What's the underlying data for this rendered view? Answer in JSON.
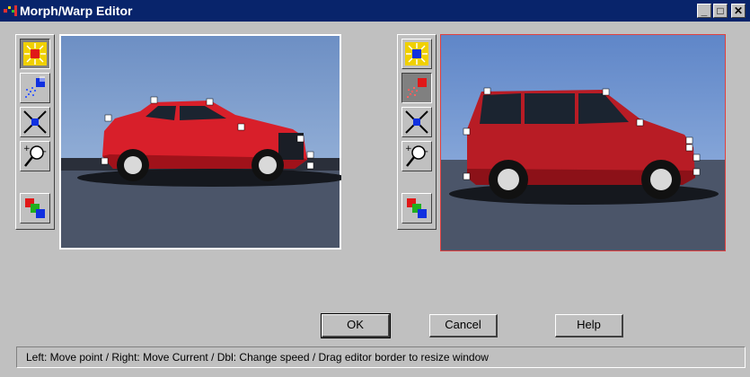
{
  "window": {
    "title": "Morph/Warp Editor",
    "controls": {
      "minimize": "_",
      "maximize": "□",
      "close": "✕"
    }
  },
  "left_toolbox": {
    "tools": [
      {
        "name": "move-point-icon",
        "pressed": true
      },
      {
        "name": "spread-points-icon",
        "pressed": false
      },
      {
        "name": "delete-point-icon",
        "pressed": false
      },
      {
        "name": "zoom-icon",
        "pressed": false
      },
      {
        "name": "color-squares-icon",
        "pressed": false
      }
    ]
  },
  "right_toolbox": {
    "tools": [
      {
        "name": "move-point-icon",
        "pressed": false
      },
      {
        "name": "spread-points-icon",
        "pressed": true
      },
      {
        "name": "delete-point-icon",
        "pressed": false
      },
      {
        "name": "zoom-icon",
        "pressed": false
      },
      {
        "name": "color-squares-icon",
        "pressed": false
      }
    ]
  },
  "source_image": {
    "subject": "red hatchback car side view",
    "frame_color": "#ffffff"
  },
  "target_image": {
    "subject": "red minivan side view",
    "frame_color": "#e04040"
  },
  "buttons": {
    "ok": "OK",
    "cancel": "Cancel",
    "help": "Help"
  },
  "status": "Left: Move point / Right: Move Current / Dbl: Change speed / Drag editor border to resize window",
  "colors": {
    "titlebar": "#08246b",
    "face": "#c0c0c0",
    "car_red": "#d81f2a"
  }
}
